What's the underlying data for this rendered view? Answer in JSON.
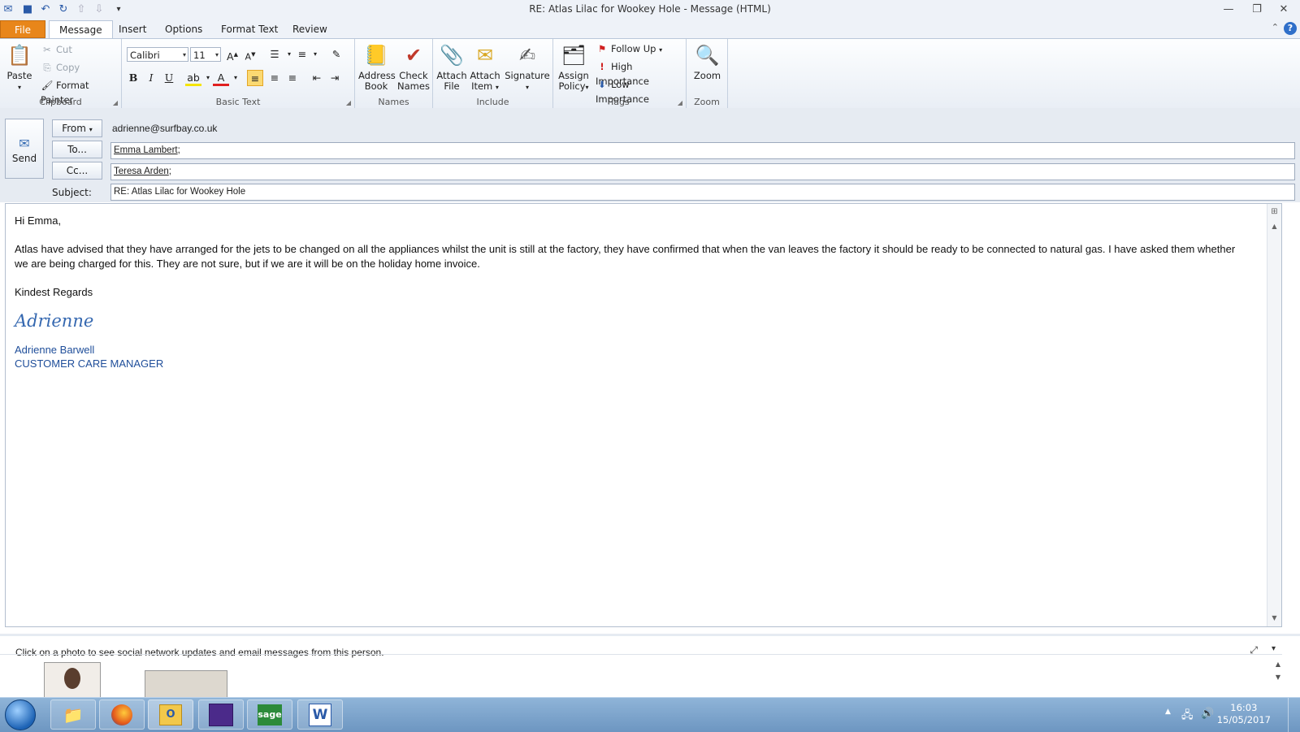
{
  "window": {
    "title": "RE: Atlas Lilac for Wookey Hole  -  Message (HTML)",
    "minimize": "—",
    "restore": "❐",
    "close": "✕",
    "help": "?",
    "ribbon_minimize": "⌃"
  },
  "quick_access": [
    "save-icon",
    "undo-icon",
    "redo-icon",
    "previous-icon",
    "next-icon",
    "customize-icon"
  ],
  "tabs": [
    {
      "label": "File"
    },
    {
      "label": "Message"
    },
    {
      "label": "Insert"
    },
    {
      "label": "Options"
    },
    {
      "label": "Format Text"
    },
    {
      "label": "Review"
    }
  ],
  "ribbon": {
    "clipboard": {
      "label": "Clipboard",
      "paste": "Paste",
      "cut": "Cut",
      "copy": "Copy",
      "format_painter": "Format Painter"
    },
    "basic_text": {
      "label": "Basic Text",
      "font": "Calibri (Body)",
      "size": "11"
    },
    "names": {
      "label": "Names",
      "address_book_1": "Address",
      "address_book_2": "Book",
      "check_names_1": "Check",
      "check_names_2": "Names"
    },
    "include": {
      "label": "Include",
      "attach_file_1": "Attach",
      "attach_file_2": "File",
      "attach_item_1": "Attach",
      "attach_item_2": "Item",
      "signature": "Signature"
    },
    "tags": {
      "label": "Tags",
      "assign_policy_1": "Assign",
      "assign_policy_2": "Policy",
      "follow_up": "Follow Up",
      "high_importance": "High Importance",
      "low_importance": "Low Importance"
    },
    "zoom": {
      "label": "Zoom",
      "zoom": "Zoom"
    }
  },
  "header": {
    "send": "Send",
    "from_button": "From",
    "from_value": "adrienne@surfbay.co.uk",
    "to_button": "To...",
    "to_value": "Emma Lambert",
    "to_sep": ";",
    "cc_button": "Cc...",
    "cc_value": "Teresa Arden",
    "cc_sep": ";",
    "subject_label": "Subject:",
    "subject_value": "RE: Atlas Lilac for Wookey Hole"
  },
  "body": {
    "greeting": "Hi Emma,",
    "paragraph": "Atlas have advised that they have arranged for the jets to be changed on all the appliances whilst the unit is still at the factory, they have confirmed that when the van leaves the factory it should be ready to be connected to natural gas.  I have asked them whether we are being charged for this.  They are not sure, but if we are it will be on the holiday home invoice.",
    "closing": "Kindest Regards",
    "signature_script": "Adrienne",
    "signature_name": "Adrienne Barwell",
    "signature_title": "CUSTOMER CARE MANAGER"
  },
  "people_pane": {
    "message": "Click on a photo to see social network updates and email messages from this person."
  },
  "taskbar": {
    "apps": [
      "windows-explorer-icon",
      "firefox-icon",
      "outlook-icon",
      "calendar-app-icon",
      "sage-icon",
      "word-icon"
    ],
    "sage_label": "sage",
    "word_label": "W",
    "time": "16:03",
    "date": "15/05/2017"
  }
}
